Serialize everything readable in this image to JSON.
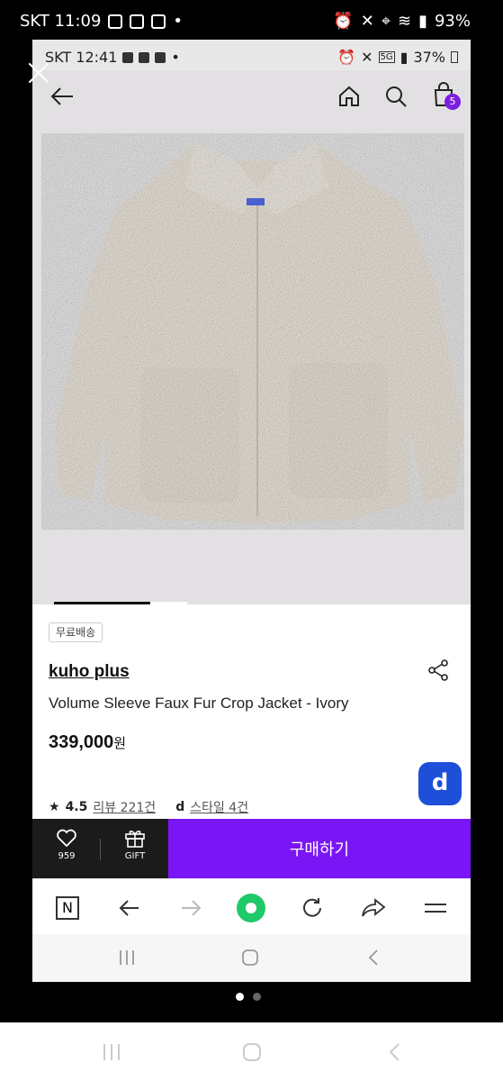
{
  "outer_status": {
    "carrier_time": "SKT 11:09",
    "battery": "93%"
  },
  "inner_status": {
    "carrier_time": "SKT 12:41",
    "battery": "37%",
    "network": "5G"
  },
  "header": {
    "cart_count": "5"
  },
  "product": {
    "free_shipping": "무료배송",
    "brand": "kuho plus",
    "name": "Volume Sleeve Faux Fur Crop Jacket - Ivory",
    "price": "339,000",
    "currency": "원",
    "rating": "4.5",
    "reviews": "리뷰 221건",
    "style": "스타일 4건",
    "d_badge": "d"
  },
  "buybar": {
    "likes": "959",
    "gift": "GIFT",
    "buy": "구매하기"
  },
  "browser": {
    "n_label": "N"
  },
  "carousel_progress": 0.72,
  "colors": {
    "accent": "#7a16f5",
    "d_badge": "#1e4fd8"
  }
}
